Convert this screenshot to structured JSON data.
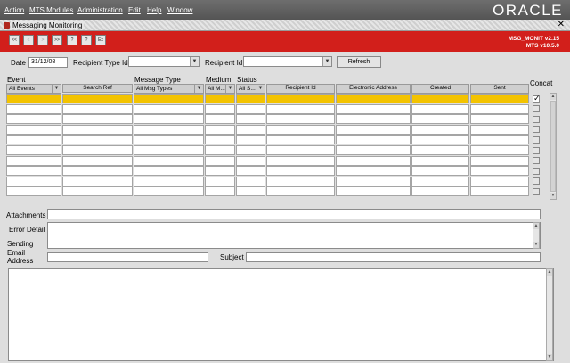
{
  "menubar": {
    "items": [
      "Action",
      "MTS Modules",
      "Administration",
      "Edit",
      "Help",
      "Window"
    ],
    "logo": "ORACLE"
  },
  "window": {
    "title": "Messaging Monitoring",
    "close": "✕"
  },
  "toolbar": {
    "buttons": [
      "<<",
      "<",
      ">",
      ">>",
      "?",
      "?",
      "Ex"
    ],
    "module": "MSG_MONIT v2.15",
    "version": "MTS v10.5.0"
  },
  "form": {
    "date_label": "Date",
    "date_value": "31/12/08",
    "recipient_type_label": "Recipient Type Id",
    "recipient_type_value": "",
    "recipient_id_label": "Recipient Id",
    "recipient_id_value": "",
    "refresh_label": "Refresh",
    "concat_label": "Concat"
  },
  "columns": {
    "event": {
      "group": "Event",
      "filter": "All Events"
    },
    "search_ref": {
      "header": "Search Ref"
    },
    "message_type": {
      "group": "Message Type",
      "filter": "All Msg Types"
    },
    "medium": {
      "group": "Medium",
      "filter": "All M..."
    },
    "status": {
      "group": "Status",
      "filter": "All S..."
    },
    "recipient_id": {
      "header": "Recipient Id"
    },
    "electronic_address": {
      "header": "Electronic Address"
    },
    "created": {
      "header": "Created"
    },
    "sent": {
      "header": "Sent"
    }
  },
  "detail": {
    "attachments_label": "Attachments",
    "error_detail_label": "Error Detail",
    "sending_email_label": "Sending Email Address",
    "subject_label": "Subject"
  }
}
